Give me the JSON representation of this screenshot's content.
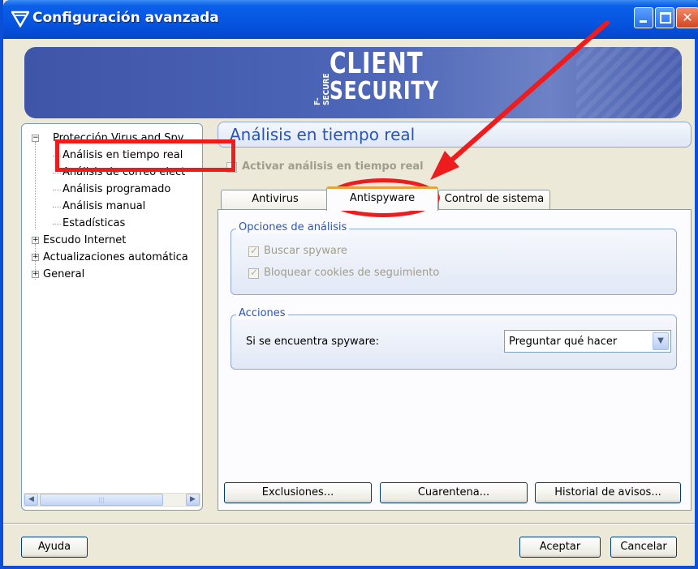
{
  "window": {
    "title": "Configuración avanzada"
  },
  "banner": {
    "brand_small": "F-SECURE",
    "brand_line1": "CLIENT",
    "brand_line2": "SECURITY"
  },
  "tree": {
    "items": [
      {
        "label": "Protección Virus and Spy",
        "level": 0,
        "expander": "−"
      },
      {
        "label": "Análisis en tiempo real",
        "level": 1
      },
      {
        "label": "Análisis de correo elect",
        "level": 1
      },
      {
        "label": "Análisis programado",
        "level": 1
      },
      {
        "label": "Análisis manual",
        "level": 1
      },
      {
        "label": "Estadísticas",
        "level": 1
      },
      {
        "label": "Escudo Internet",
        "level": 0,
        "expander": "+"
      },
      {
        "label": "Actualizaciones automática",
        "level": 0,
        "expander": "+"
      },
      {
        "label": "General",
        "level": 0,
        "expander": "+"
      }
    ]
  },
  "section": {
    "title": "Análisis en tiempo real",
    "enable_label": "Activar análisis en tiempo real"
  },
  "tabs": [
    {
      "label": "Antivirus",
      "active": false
    },
    {
      "label": "Antispyware",
      "active": true
    },
    {
      "label": "Control de sistema",
      "active": false
    }
  ],
  "analysis_options": {
    "title": "Opciones de análisis",
    "option1": "Buscar spyware",
    "option2": "Bloquear cookies de seguimiento"
  },
  "actions": {
    "title": "Acciones",
    "spyware_label": "Si se encuentra spyware:",
    "spyware_action": "Preguntar qué hacer"
  },
  "buttons": {
    "exclusions": "Exclusiones...",
    "quarantine": "Cuarentena...",
    "history": "Historial de avisos...",
    "help": "Ayuda",
    "accept": "Aceptar",
    "cancel": "Cancelar"
  },
  "colors": {
    "titlebar": "#0654e0",
    "accent_blue": "#2a55b5",
    "annotation_red": "#ee1c1c",
    "active_tab_top": "#e8a33a"
  }
}
